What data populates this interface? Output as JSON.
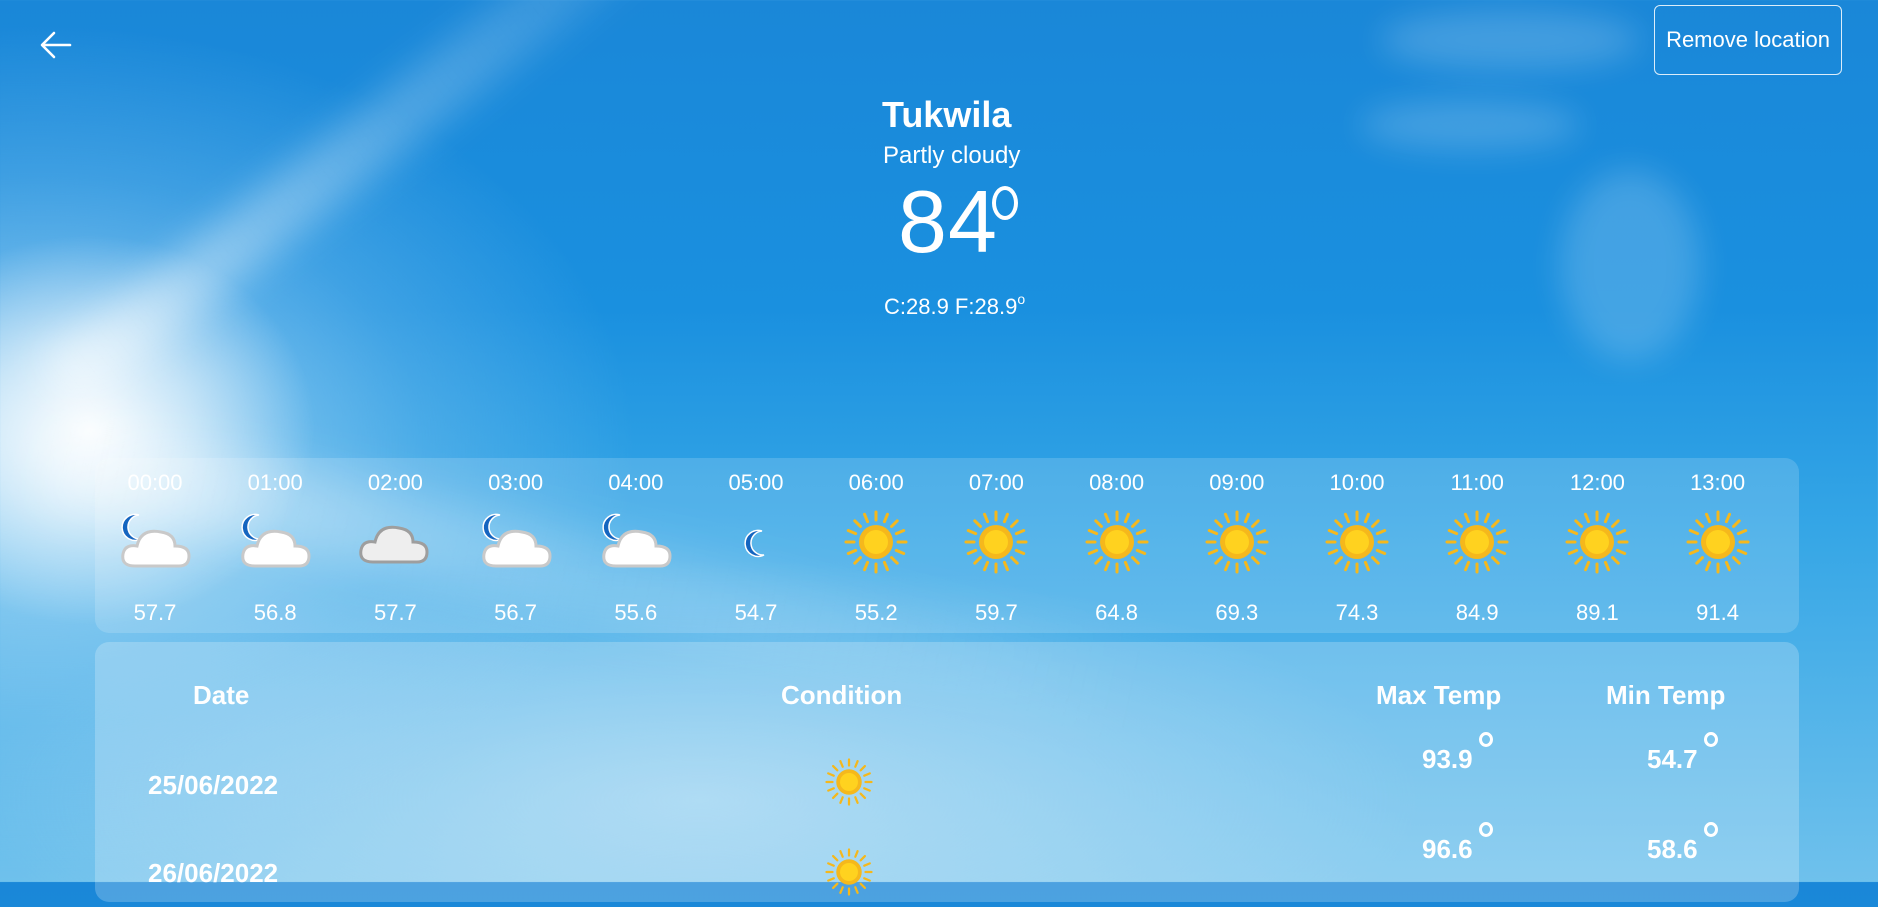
{
  "header": {
    "remove_location_label": "Remove location"
  },
  "current": {
    "city": "Tukwila",
    "condition": "Partly cloudy",
    "temperature": "84",
    "secondary": "C:28.9 F:28.9"
  },
  "hourly": [
    {
      "time": "00:00",
      "value": "57.7",
      "icon": "cloud-moon-icon"
    },
    {
      "time": "01:00",
      "value": "56.8",
      "icon": "cloud-moon-icon"
    },
    {
      "time": "02:00",
      "value": "57.7",
      "icon": "cloud-icon"
    },
    {
      "time": "03:00",
      "value": "56.7",
      "icon": "cloud-moon-icon"
    },
    {
      "time": "04:00",
      "value": "55.6",
      "icon": "cloud-moon-icon"
    },
    {
      "time": "05:00",
      "value": "54.7",
      "icon": "moon-icon"
    },
    {
      "time": "06:00",
      "value": "55.2",
      "icon": "sun-icon"
    },
    {
      "time": "07:00",
      "value": "59.7",
      "icon": "sun-icon"
    },
    {
      "time": "08:00",
      "value": "64.8",
      "icon": "sun-icon"
    },
    {
      "time": "09:00",
      "value": "69.3",
      "icon": "sun-icon"
    },
    {
      "time": "10:00",
      "value": "74.3",
      "icon": "sun-icon"
    },
    {
      "time": "11:00",
      "value": "84.9",
      "icon": "sun-icon"
    },
    {
      "time": "12:00",
      "value": "89.1",
      "icon": "sun-icon"
    },
    {
      "time": "13:00",
      "value": "91.4",
      "icon": "sun-icon"
    }
  ],
  "daily": {
    "headers": {
      "date": "Date",
      "condition": "Condition",
      "max": "Max Temp",
      "min": "Min Temp"
    },
    "rows": [
      {
        "date": "25/06/2022",
        "icon": "sun-icon",
        "max": "93.9",
        "min": "54.7"
      },
      {
        "date": "26/06/2022",
        "icon": "sun-icon",
        "max": "96.6",
        "min": "58.6"
      }
    ]
  },
  "colors": {
    "sky_top": "#1a87d8",
    "sun": "#ffd21f",
    "sun_ray": "#f5b81c",
    "moon": "#1565c0"
  }
}
